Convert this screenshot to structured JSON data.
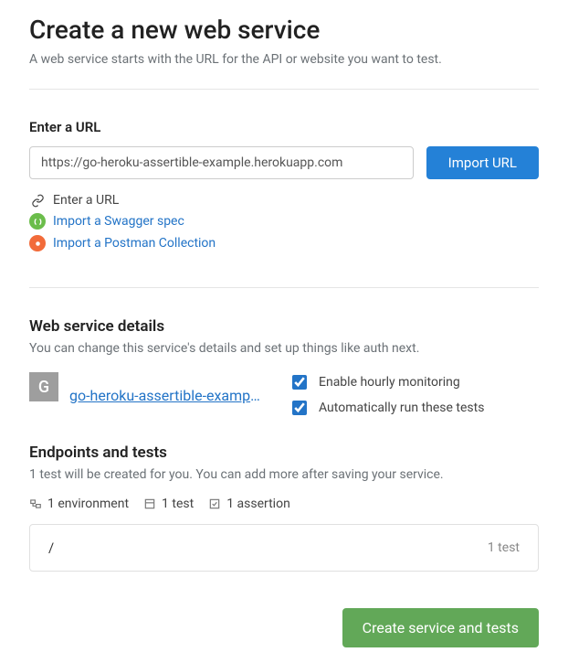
{
  "header": {
    "title": "Create a new web service",
    "subtitle": "A web service starts with the URL for the API or website you want to test."
  },
  "url_section": {
    "label": "Enter a URL",
    "input_value": "https://go-heroku-assertible-example.herokuapp.com",
    "import_button": "Import URL",
    "options": {
      "enter_url": "Enter a URL",
      "swagger": "Import a Swagger spec",
      "postman": "Import a Postman Collection"
    }
  },
  "details": {
    "heading": "Web service details",
    "sub": "You can change this service's details and set up things like auth next.",
    "icon_letter": "G",
    "service_name": "go-heroku-assertible-exampl…",
    "monitor_label": "Enable hourly monitoring",
    "autorun_label": "Automatically run these tests"
  },
  "endpoints": {
    "heading": "Endpoints and tests",
    "sub": "1 test will be created for you. You can add more after saving your service.",
    "stats": {
      "environments": "1 environment",
      "tests": "1 test",
      "assertions": "1 assertion"
    },
    "row": {
      "path": "/",
      "count": "1 test"
    }
  },
  "footer": {
    "create_button": "Create service and tests"
  }
}
